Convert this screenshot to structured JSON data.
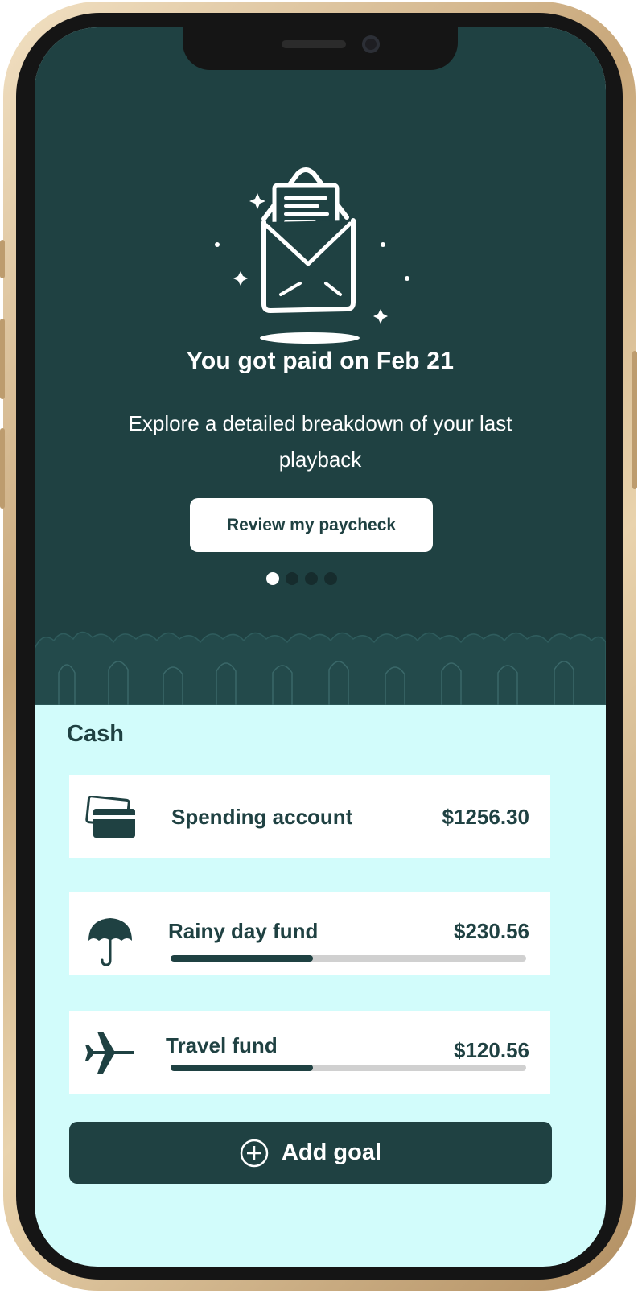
{
  "hero": {
    "title": "You got paid on Feb 21",
    "subtitle": "Explore a detailed breakdown of your last playback",
    "cta_label": "Review my paycheck",
    "page_count": 4,
    "active_page": 1
  },
  "cash": {
    "title": "Cash",
    "accounts": [
      {
        "label": "Spending account",
        "amount": "$1256.30",
        "icon": "credit-card-icon"
      },
      {
        "label": "Rainy day fund",
        "amount": "$230.56",
        "icon": "umbrella-icon",
        "progress": 0.4
      },
      {
        "label": "Travel fund",
        "amount": "$120.56",
        "icon": "airplane-icon",
        "progress": 0.4
      }
    ]
  },
  "add_goal_label": "Add goal",
  "colors": {
    "primary": "#1f4142",
    "background": "#d2fcfb",
    "card": "#ffffff",
    "track": "#d0d0d0"
  }
}
